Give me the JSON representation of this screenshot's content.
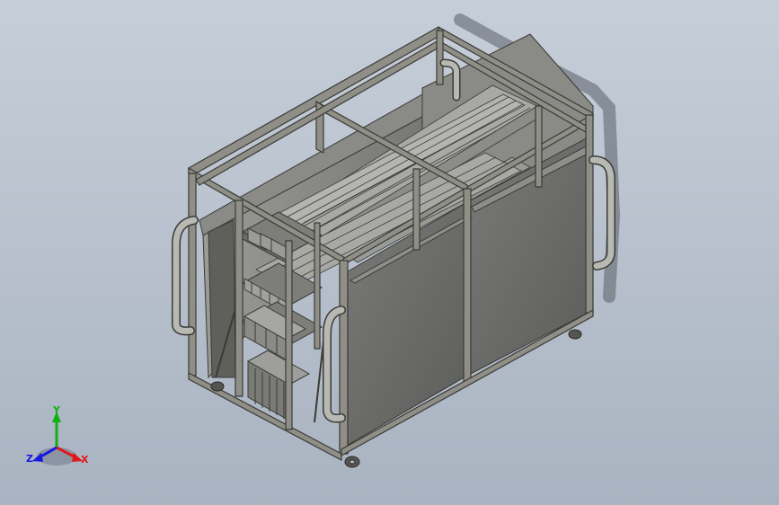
{
  "viewport": {
    "background_top": "#c6ced8",
    "background_bottom": "#a9b3c1"
  },
  "model": {
    "frame_color": "#8f8f88",
    "frame_edge": "#3a3a36",
    "panel_color": "#6b6b69",
    "shelf_color": "#7d7d7a"
  },
  "triad": {
    "x_label": "X",
    "y_label": "Y",
    "z_label": "Z",
    "x_color": "#e01818",
    "y_color": "#10b010",
    "z_color": "#1818e0"
  }
}
